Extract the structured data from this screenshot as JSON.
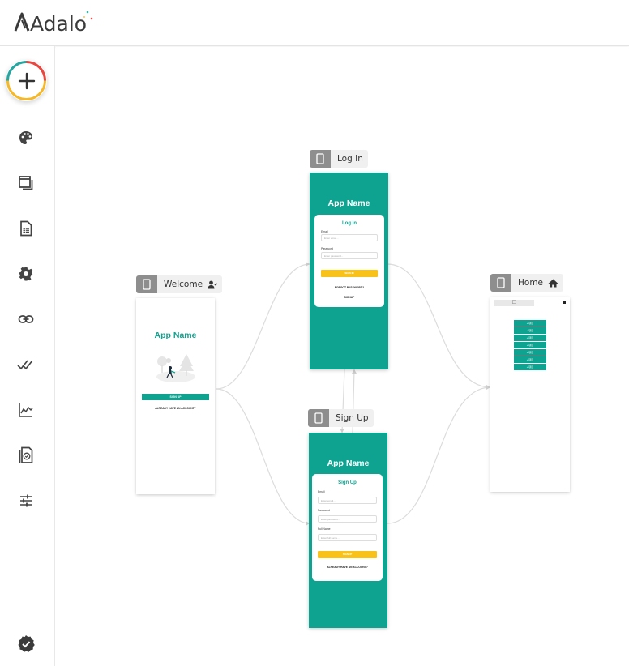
{
  "app": {
    "logo_text": "Adalo",
    "brand_color": "#0ea390",
    "accent_yellow": "#f8c21a"
  },
  "sidebar": {
    "add_button_icon": "plus-icon",
    "items": [
      {
        "icon": "palette-icon"
      },
      {
        "icon": "screens-icon"
      },
      {
        "icon": "database-icon"
      },
      {
        "icon": "settings-icon"
      },
      {
        "icon": "link-icon"
      },
      {
        "icon": "double-check-icon"
      },
      {
        "icon": "analytics-icon"
      },
      {
        "icon": "publish-icon"
      },
      {
        "icon": "sliders-icon"
      }
    ],
    "bottom_icon": "verified-badge-icon"
  },
  "screens": {
    "welcome": {
      "label": "Welcome",
      "app_name": "App Name",
      "signup_button": "SIGN UP",
      "already_link": "ALREADY HAVE AN ACCOUNT?"
    },
    "login": {
      "label": "Log In",
      "app_name": "App Name",
      "card_title": "Log In",
      "email_label": "Email",
      "email_placeholder": "Enter email...",
      "password_label": "Password",
      "password_placeholder": "Enter password...",
      "signin_button": "SIGN IN",
      "forgot_link": "FORGOT PASSWORD?",
      "signup_link": "SIGNUP"
    },
    "signup": {
      "label": "Sign Up",
      "app_name": "App Name",
      "card_title": "Sign Up",
      "email_label": "Email",
      "email_placeholder": "Enter email...",
      "password_label": "Password",
      "password_placeholder": "Enter password...",
      "fullname_label": "Full Name",
      "fullname_placeholder": "Enter full name...",
      "signup_button": "SIGNUP",
      "already_link": "ALREADY HAVE AN ACCOUNT?"
    },
    "home": {
      "label": "Home",
      "tab_icon": "calendar-icon",
      "buttons": [
        "+ 项目",
        "+ 项目",
        "+ 项目",
        "+ 项目",
        "+ 项目",
        "+ 项目",
        "+ 项目"
      ]
    }
  }
}
